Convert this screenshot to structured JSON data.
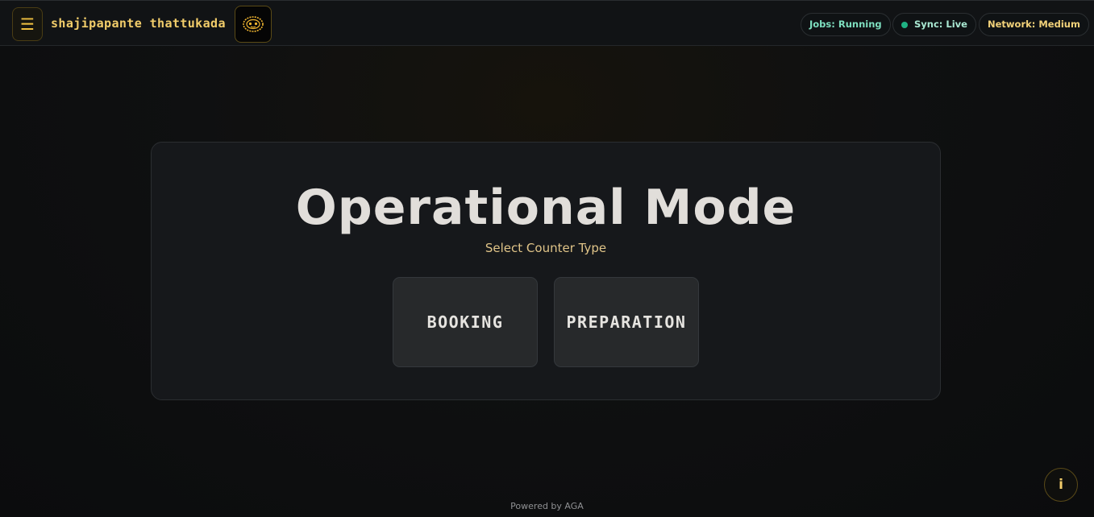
{
  "header": {
    "menu_icon": "☰",
    "brand": "shajipapante thattukada",
    "logo_icon": "robot-face-icon",
    "status": {
      "jobs": "Jobs: Running",
      "sync": "Sync: Live",
      "network": "Network: Medium"
    }
  },
  "main": {
    "title": "Operational Mode",
    "subtitle": "Select Counter Type",
    "buttons": {
      "booking": "BOOKING",
      "preparation": "PREPARATION"
    }
  },
  "footer": {
    "text": "Powered by AGA"
  },
  "info_button": {
    "label": "i"
  },
  "colors": {
    "accent": "#f2cd6a",
    "sync_dot": "#1fb283",
    "jobs_text": "#7ee0c0",
    "background": "#0f1011",
    "card": "#16181b"
  }
}
